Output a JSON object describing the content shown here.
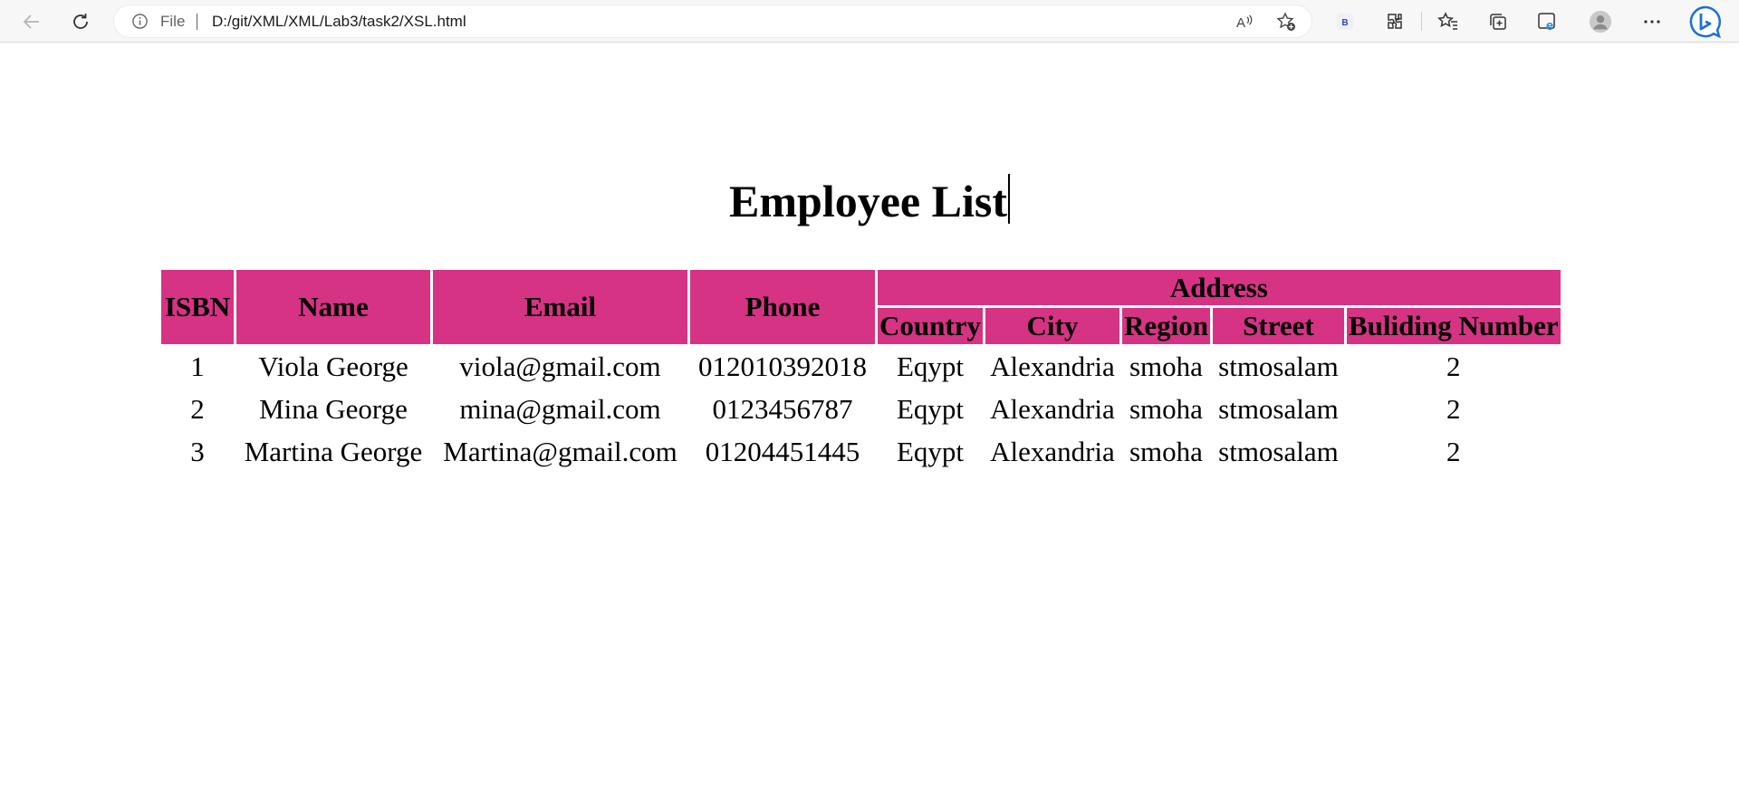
{
  "browser": {
    "address_scheme": "File",
    "url": "D:/git/XML/XML/Lab3/task2/XSL.html",
    "icons": [
      "back-arrow-icon",
      "refresh-icon",
      "info-icon",
      "read-aloud-icon",
      "add-favorite-icon",
      "extension-b-icon",
      "extensions-icon",
      "favorites-icon",
      "collections-icon",
      "edge-ie-mode-icon",
      "profile-icon",
      "more-icon",
      "bing-copilot-icon"
    ],
    "extension_label": "B"
  },
  "page": {
    "title": "Employee List"
  },
  "table": {
    "headers": {
      "isbn": "ISBN",
      "name": "Name",
      "email": "Email",
      "phone": "Phone",
      "address": "Address",
      "country": "Country",
      "city": "City",
      "region": "Region",
      "street": "Street",
      "building": "Buliding Number"
    },
    "header_color": "#d63384",
    "rows": [
      {
        "isbn": "1",
        "name": "Viola George",
        "email": "viola@gmail.com",
        "phone": "012010392018",
        "country": "Eqypt",
        "city": "Alexandria",
        "region": "smoha",
        "street": "stmosalam",
        "building": "2"
      },
      {
        "isbn": "2",
        "name": "Mina George",
        "email": "mina@gmail.com",
        "phone": "0123456787",
        "country": "Eqypt",
        "city": "Alexandria",
        "region": "smoha",
        "street": "stmosalam",
        "building": "2"
      },
      {
        "isbn": "3",
        "name": "Martina George",
        "email": "Martina@gmail.com",
        "phone": "01204451445",
        "country": "Eqypt",
        "city": "Alexandria",
        "region": "smoha",
        "street": "stmosalam",
        "building": "2"
      }
    ]
  }
}
